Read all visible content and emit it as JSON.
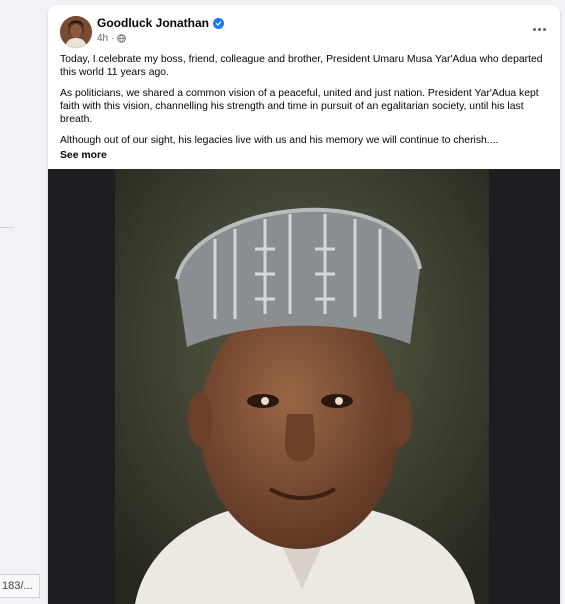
{
  "post": {
    "author": "Goodluck Jonathan",
    "time": "4h",
    "paragraphs": [
      "Today, I  celebrate my boss, friend, colleague and brother, President Umaru Musa Yar'Adua who departed this world 11 years ago.",
      "As politicians, we shared a common vision of a peaceful, united and just nation. President Yar'Adua kept faith with this vision,  channelling his strength and time in pursuit of an egalitarian society, until his last breath.",
      "Although out of our sight, his legacies live with us and his memory we will continue to cherish...."
    ],
    "see_more": "See more"
  },
  "status_bar": {
    "url": "183/..."
  },
  "colors": {
    "verified": "#1877f2",
    "background": "#f0f2f5",
    "muted_text": "#65676b"
  },
  "icons": [
    "verified-badge-icon",
    "globe-icon",
    "more-options-icon"
  ]
}
